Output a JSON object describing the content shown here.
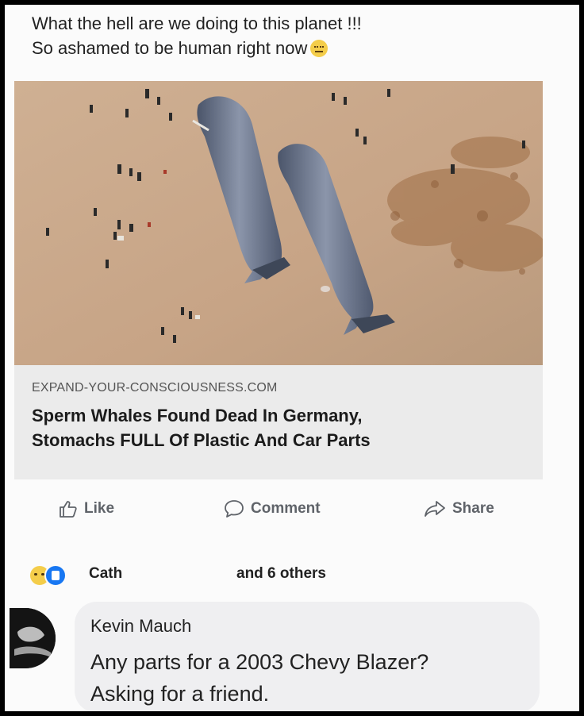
{
  "post": {
    "text_line1": "What the hell are we doing to this planet !!!",
    "text_line2": "So ashamed to be human right now",
    "emoji_icon": "worried-face-emoji"
  },
  "link_preview": {
    "image_description_icon": "beached-whales-photo",
    "domain": "EXPAND-YOUR-CONSCIOUSNESS.COM",
    "title_line1": "Sperm Whales Found Dead In Germany,",
    "title_line2": "Stomachs FULL Of Plastic And Car Parts"
  },
  "actions": {
    "like_label": "Like",
    "comment_label": "Comment",
    "share_label": "Share"
  },
  "reactions": {
    "name": "Cath",
    "others": "and 6 others"
  },
  "comment": {
    "author": "Kevin Mauch",
    "text_line1": "Any parts for a 2003 Chevy Blazer?",
    "text_line2": "Asking for a friend."
  },
  "colors": {
    "sand": "#c9a888",
    "whale": "#5f6b82",
    "like_blue": "#1877f2",
    "reaction_yellow": "#f4cd4a"
  }
}
